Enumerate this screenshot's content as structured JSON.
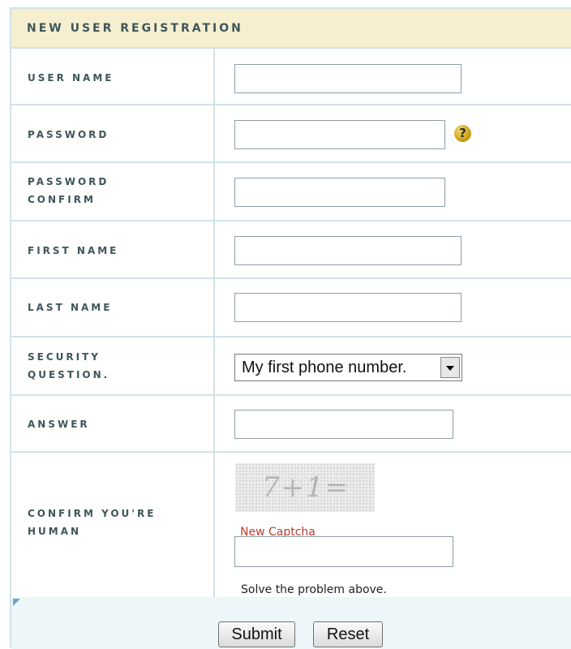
{
  "form": {
    "title": "NEW USER REGISTRATION",
    "fields": {
      "username": {
        "label": "USER NAME",
        "value": ""
      },
      "password": {
        "label": "PASSWORD",
        "value": ""
      },
      "password_confirm": {
        "label": "PASSWORD\nCONFIRM",
        "value": ""
      },
      "first_name": {
        "label": "FIRST NAME",
        "value": ""
      },
      "last_name": {
        "label": "LAST NAME",
        "value": ""
      },
      "security_question": {
        "label": "SECURITY\nQUESTION.",
        "selected": "My first phone number."
      },
      "answer": {
        "label": "ANSWER",
        "value": ""
      },
      "captcha": {
        "label": "CONFIRM YOU'RE\nHUMAN",
        "image_text": "7+1=",
        "new_link": "New Captcha",
        "hint": "Solve the problem above.",
        "value": ""
      }
    },
    "help_icon": "question-mark-icon",
    "buttons": {
      "submit": "Submit",
      "reset": "Reset"
    }
  }
}
